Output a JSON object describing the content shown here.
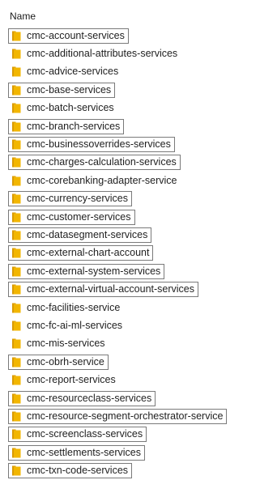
{
  "header": {
    "column_name": "Name"
  },
  "colors": {
    "folder": "#f2b600",
    "folder_shade": "#d99a00",
    "box_border": "#7a7a7a"
  },
  "items": [
    {
      "label": "cmc-account-services",
      "icon": "folder-icon",
      "boxed": true
    },
    {
      "label": "cmc-additional-attributes-services",
      "icon": "folder-icon",
      "boxed": false
    },
    {
      "label": "cmc-advice-services",
      "icon": "folder-icon",
      "boxed": false
    },
    {
      "label": "cmc-base-services",
      "icon": "folder-icon",
      "boxed": true
    },
    {
      "label": "cmc-batch-services",
      "icon": "folder-icon",
      "boxed": false
    },
    {
      "label": "cmc-branch-services",
      "icon": "folder-icon",
      "boxed": true
    },
    {
      "label": "cmc-businessoverrides-services",
      "icon": "folder-icon",
      "boxed": true
    },
    {
      "label": "cmc-charges-calculation-services",
      "icon": "folder-icon",
      "boxed": true
    },
    {
      "label": "cmc-corebanking-adapter-service",
      "icon": "folder-icon",
      "boxed": false
    },
    {
      "label": "cmc-currency-services",
      "icon": "folder-icon",
      "boxed": true
    },
    {
      "label": "cmc-customer-services",
      "icon": "folder-icon",
      "boxed": true
    },
    {
      "label": "cmc-datasegment-services",
      "icon": "folder-icon",
      "boxed": true
    },
    {
      "label": "cmc-external-chart-account",
      "icon": "folder-icon",
      "boxed": true
    },
    {
      "label": "cmc-external-system-services",
      "icon": "folder-icon",
      "boxed": true
    },
    {
      "label": "cmc-external-virtual-account-services",
      "icon": "folder-icon",
      "boxed": true
    },
    {
      "label": "cmc-facilities-service",
      "icon": "folder-icon",
      "boxed": false
    },
    {
      "label": "cmc-fc-ai-ml-services",
      "icon": "folder-icon",
      "boxed": false
    },
    {
      "label": "cmc-mis-services",
      "icon": "folder-icon",
      "boxed": false
    },
    {
      "label": "cmc-obrh-service",
      "icon": "folder-icon",
      "boxed": true
    },
    {
      "label": "cmc-report-services",
      "icon": "folder-icon",
      "boxed": false
    },
    {
      "label": "cmc-resourceclass-services",
      "icon": "folder-icon",
      "boxed": true
    },
    {
      "label": "cmc-resource-segment-orchestrator-service",
      "icon": "folder-icon",
      "boxed": true
    },
    {
      "label": "cmc-screenclass-services",
      "icon": "folder-icon",
      "boxed": true
    },
    {
      "label": "cmc-settlements-services",
      "icon": "folder-icon",
      "boxed": true
    },
    {
      "label": "cmc-txn-code-services",
      "icon": "folder-icon",
      "boxed": true
    }
  ]
}
